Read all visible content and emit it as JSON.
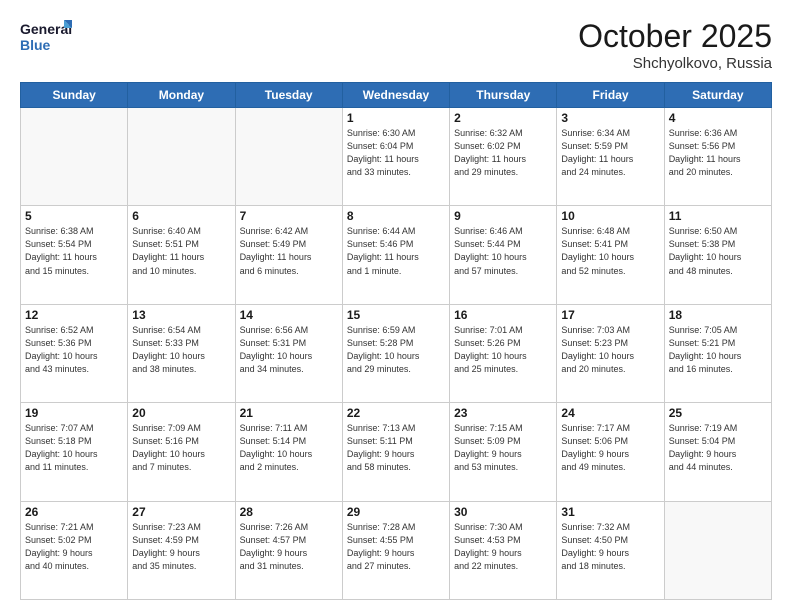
{
  "logo": {
    "line1": "General",
    "line2": "Blue"
  },
  "title": "October 2025",
  "location": "Shchyolkovo, Russia",
  "weekdays": [
    "Sunday",
    "Monday",
    "Tuesday",
    "Wednesday",
    "Thursday",
    "Friday",
    "Saturday"
  ],
  "weeks": [
    [
      {
        "day": "",
        "info": ""
      },
      {
        "day": "",
        "info": ""
      },
      {
        "day": "",
        "info": ""
      },
      {
        "day": "1",
        "info": "Sunrise: 6:30 AM\nSunset: 6:04 PM\nDaylight: 11 hours\nand 33 minutes."
      },
      {
        "day": "2",
        "info": "Sunrise: 6:32 AM\nSunset: 6:02 PM\nDaylight: 11 hours\nand 29 minutes."
      },
      {
        "day": "3",
        "info": "Sunrise: 6:34 AM\nSunset: 5:59 PM\nDaylight: 11 hours\nand 24 minutes."
      },
      {
        "day": "4",
        "info": "Sunrise: 6:36 AM\nSunset: 5:56 PM\nDaylight: 11 hours\nand 20 minutes."
      }
    ],
    [
      {
        "day": "5",
        "info": "Sunrise: 6:38 AM\nSunset: 5:54 PM\nDaylight: 11 hours\nand 15 minutes."
      },
      {
        "day": "6",
        "info": "Sunrise: 6:40 AM\nSunset: 5:51 PM\nDaylight: 11 hours\nand 10 minutes."
      },
      {
        "day": "7",
        "info": "Sunrise: 6:42 AM\nSunset: 5:49 PM\nDaylight: 11 hours\nand 6 minutes."
      },
      {
        "day": "8",
        "info": "Sunrise: 6:44 AM\nSunset: 5:46 PM\nDaylight: 11 hours\nand 1 minute."
      },
      {
        "day": "9",
        "info": "Sunrise: 6:46 AM\nSunset: 5:44 PM\nDaylight: 10 hours\nand 57 minutes."
      },
      {
        "day": "10",
        "info": "Sunrise: 6:48 AM\nSunset: 5:41 PM\nDaylight: 10 hours\nand 52 minutes."
      },
      {
        "day": "11",
        "info": "Sunrise: 6:50 AM\nSunset: 5:38 PM\nDaylight: 10 hours\nand 48 minutes."
      }
    ],
    [
      {
        "day": "12",
        "info": "Sunrise: 6:52 AM\nSunset: 5:36 PM\nDaylight: 10 hours\nand 43 minutes."
      },
      {
        "day": "13",
        "info": "Sunrise: 6:54 AM\nSunset: 5:33 PM\nDaylight: 10 hours\nand 38 minutes."
      },
      {
        "day": "14",
        "info": "Sunrise: 6:56 AM\nSunset: 5:31 PM\nDaylight: 10 hours\nand 34 minutes."
      },
      {
        "day": "15",
        "info": "Sunrise: 6:59 AM\nSunset: 5:28 PM\nDaylight: 10 hours\nand 29 minutes."
      },
      {
        "day": "16",
        "info": "Sunrise: 7:01 AM\nSunset: 5:26 PM\nDaylight: 10 hours\nand 25 minutes."
      },
      {
        "day": "17",
        "info": "Sunrise: 7:03 AM\nSunset: 5:23 PM\nDaylight: 10 hours\nand 20 minutes."
      },
      {
        "day": "18",
        "info": "Sunrise: 7:05 AM\nSunset: 5:21 PM\nDaylight: 10 hours\nand 16 minutes."
      }
    ],
    [
      {
        "day": "19",
        "info": "Sunrise: 7:07 AM\nSunset: 5:18 PM\nDaylight: 10 hours\nand 11 minutes."
      },
      {
        "day": "20",
        "info": "Sunrise: 7:09 AM\nSunset: 5:16 PM\nDaylight: 10 hours\nand 7 minutes."
      },
      {
        "day": "21",
        "info": "Sunrise: 7:11 AM\nSunset: 5:14 PM\nDaylight: 10 hours\nand 2 minutes."
      },
      {
        "day": "22",
        "info": "Sunrise: 7:13 AM\nSunset: 5:11 PM\nDaylight: 9 hours\nand 58 minutes."
      },
      {
        "day": "23",
        "info": "Sunrise: 7:15 AM\nSunset: 5:09 PM\nDaylight: 9 hours\nand 53 minutes."
      },
      {
        "day": "24",
        "info": "Sunrise: 7:17 AM\nSunset: 5:06 PM\nDaylight: 9 hours\nand 49 minutes."
      },
      {
        "day": "25",
        "info": "Sunrise: 7:19 AM\nSunset: 5:04 PM\nDaylight: 9 hours\nand 44 minutes."
      }
    ],
    [
      {
        "day": "26",
        "info": "Sunrise: 7:21 AM\nSunset: 5:02 PM\nDaylight: 9 hours\nand 40 minutes."
      },
      {
        "day": "27",
        "info": "Sunrise: 7:23 AM\nSunset: 4:59 PM\nDaylight: 9 hours\nand 35 minutes."
      },
      {
        "day": "28",
        "info": "Sunrise: 7:26 AM\nSunset: 4:57 PM\nDaylight: 9 hours\nand 31 minutes."
      },
      {
        "day": "29",
        "info": "Sunrise: 7:28 AM\nSunset: 4:55 PM\nDaylight: 9 hours\nand 27 minutes."
      },
      {
        "day": "30",
        "info": "Sunrise: 7:30 AM\nSunset: 4:53 PM\nDaylight: 9 hours\nand 22 minutes."
      },
      {
        "day": "31",
        "info": "Sunrise: 7:32 AM\nSunset: 4:50 PM\nDaylight: 9 hours\nand 18 minutes."
      },
      {
        "day": "",
        "info": ""
      }
    ]
  ]
}
